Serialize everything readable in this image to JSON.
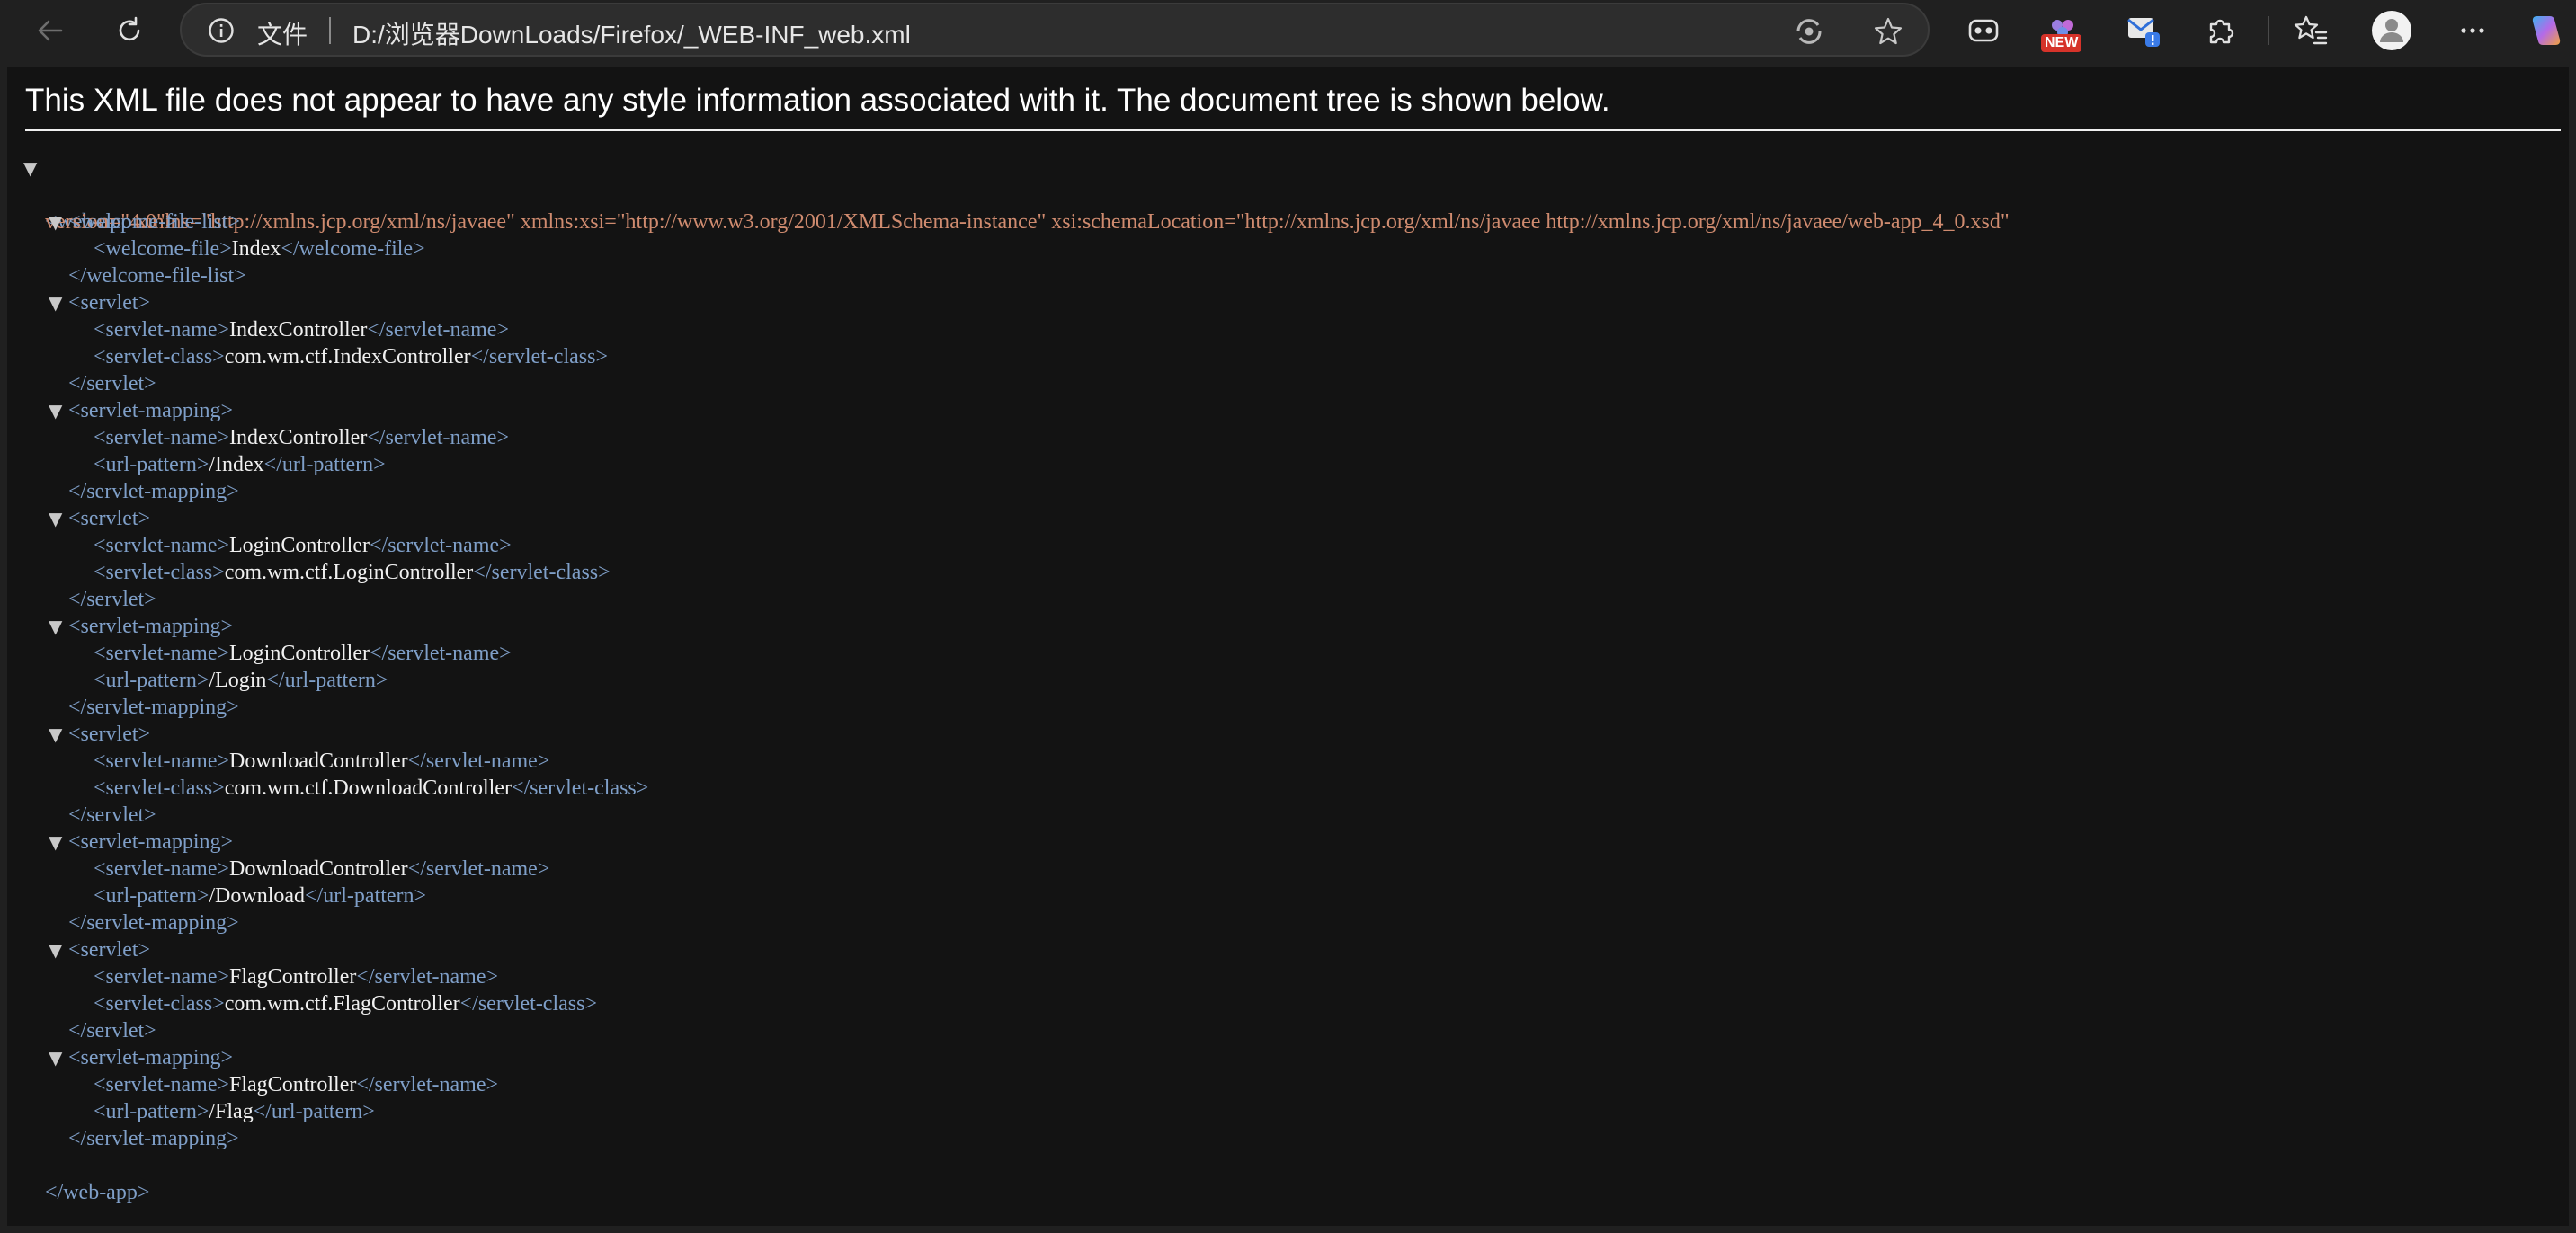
{
  "browser": {
    "address": {
      "scheme_label": "文件",
      "url": "D:/浏览器DownLoads/Firefox/_WEB-INF_web.xml"
    },
    "badge_new": "NEW",
    "icons": [
      "back-arrow-icon",
      "refresh-icon",
      "site-info-icon",
      "immersive-reader-icon",
      "favorite-star-icon",
      "game-controller-icon",
      "extension-new-icon",
      "mail-extension-icon",
      "extensions-puzzle-icon",
      "favorites-icon",
      "profile-avatar-icon",
      "more-menu-icon",
      "copilot-icon"
    ]
  },
  "page": {
    "notice": "This XML file does not appear to have any style information associated with it. The document tree is shown below."
  },
  "xml": {
    "root_open": "<web-app",
    "root_attrs": [
      {
        "name": " xmlns=",
        "value": "\"http://xmlns.jcp.org/xml/ns/javaee\""
      },
      {
        "name": " xmlns:xsi=",
        "value": "\"http://www.w3.org/2001/XMLSchema-instance\""
      },
      {
        "name": " xsi:schemaLocation=",
        "value": "\"http://xmlns.jcp.org/xml/ns/javaee http://xmlns.jcp.org/xml/ns/javaee/web-app_4_0.xsd\""
      }
    ],
    "version_name": "version=",
    "version_value": "\"4.0\"",
    "root_close": "</web-app>",
    "blocks": [
      {
        "open": "<welcome-file-list>",
        "close": "</welcome-file-list>",
        "children": [
          {
            "open": "<welcome-file>",
            "text": "Index",
            "close": "</welcome-file>"
          }
        ]
      },
      {
        "open": "<servlet>",
        "close": "</servlet>",
        "children": [
          {
            "open": "<servlet-name>",
            "text": "IndexController",
            "close": "</servlet-name>"
          },
          {
            "open": "<servlet-class>",
            "text": "com.wm.ctf.IndexController",
            "close": "</servlet-class>"
          }
        ]
      },
      {
        "open": "<servlet-mapping>",
        "close": "</servlet-mapping>",
        "children": [
          {
            "open": "<servlet-name>",
            "text": "IndexController",
            "close": "</servlet-name>"
          },
          {
            "open": "<url-pattern>",
            "text": "/Index",
            "close": "</url-pattern>"
          }
        ]
      },
      {
        "open": "<servlet>",
        "close": "</servlet>",
        "children": [
          {
            "open": "<servlet-name>",
            "text": "LoginController",
            "close": "</servlet-name>"
          },
          {
            "open": "<servlet-class>",
            "text": "com.wm.ctf.LoginController",
            "close": "</servlet-class>"
          }
        ]
      },
      {
        "open": "<servlet-mapping>",
        "close": "</servlet-mapping>",
        "children": [
          {
            "open": "<servlet-name>",
            "text": "LoginController",
            "close": "</servlet-name>"
          },
          {
            "open": "<url-pattern>",
            "text": "/Login",
            "close": "</url-pattern>"
          }
        ]
      },
      {
        "open": "<servlet>",
        "close": "</servlet>",
        "children": [
          {
            "open": "<servlet-name>",
            "text": "DownloadController",
            "close": "</servlet-name>"
          },
          {
            "open": "<servlet-class>",
            "text": "com.wm.ctf.DownloadController",
            "close": "</servlet-class>"
          }
        ]
      },
      {
        "open": "<servlet-mapping>",
        "close": "</servlet-mapping>",
        "children": [
          {
            "open": "<servlet-name>",
            "text": "DownloadController",
            "close": "</servlet-name>"
          },
          {
            "open": "<url-pattern>",
            "text": "/Download",
            "close": "</url-pattern>"
          }
        ]
      },
      {
        "open": "<servlet>",
        "close": "</servlet>",
        "children": [
          {
            "open": "<servlet-name>",
            "text": "FlagController",
            "close": "</servlet-name>"
          },
          {
            "open": "<servlet-class>",
            "text": "com.wm.ctf.FlagController",
            "close": "</servlet-class>"
          }
        ]
      },
      {
        "open": "<servlet-mapping>",
        "close": "</servlet-mapping>",
        "children": [
          {
            "open": "<servlet-name>",
            "text": "FlagController",
            "close": "</servlet-name>"
          },
          {
            "open": "<url-pattern>",
            "text": "/Flag",
            "close": "</url-pattern>"
          }
        ]
      }
    ]
  }
}
